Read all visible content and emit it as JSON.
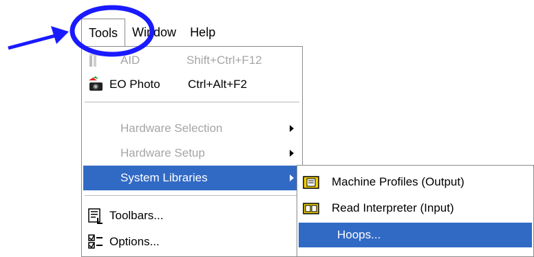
{
  "menubar": {
    "items": [
      "Tools",
      "Window",
      "Help"
    ]
  },
  "tools_menu": {
    "items": [
      {
        "label": "AID",
        "shortcut": "Shift+Ctrl+F12",
        "disabled": true
      },
      {
        "label": "EO Photo",
        "shortcut": "Ctrl+Alt+F2",
        "disabled": false
      },
      {
        "label": "Hardware Selection",
        "disabled": true
      },
      {
        "label": "Hardware Setup",
        "disabled": true
      },
      {
        "label": "System Libraries",
        "selected": true
      },
      {
        "label": "Toolbars..."
      },
      {
        "label": "Options..."
      }
    ]
  },
  "submenu": {
    "items": [
      {
        "label": "Machine Profiles (Output)"
      },
      {
        "label": "Read Interpreter (Input)"
      },
      {
        "label": "Hoops...",
        "selected": true
      }
    ]
  },
  "colors": {
    "highlight": "#316ac5",
    "annotation": "#1a1aff",
    "disabled_text": "#a5a5a5"
  }
}
